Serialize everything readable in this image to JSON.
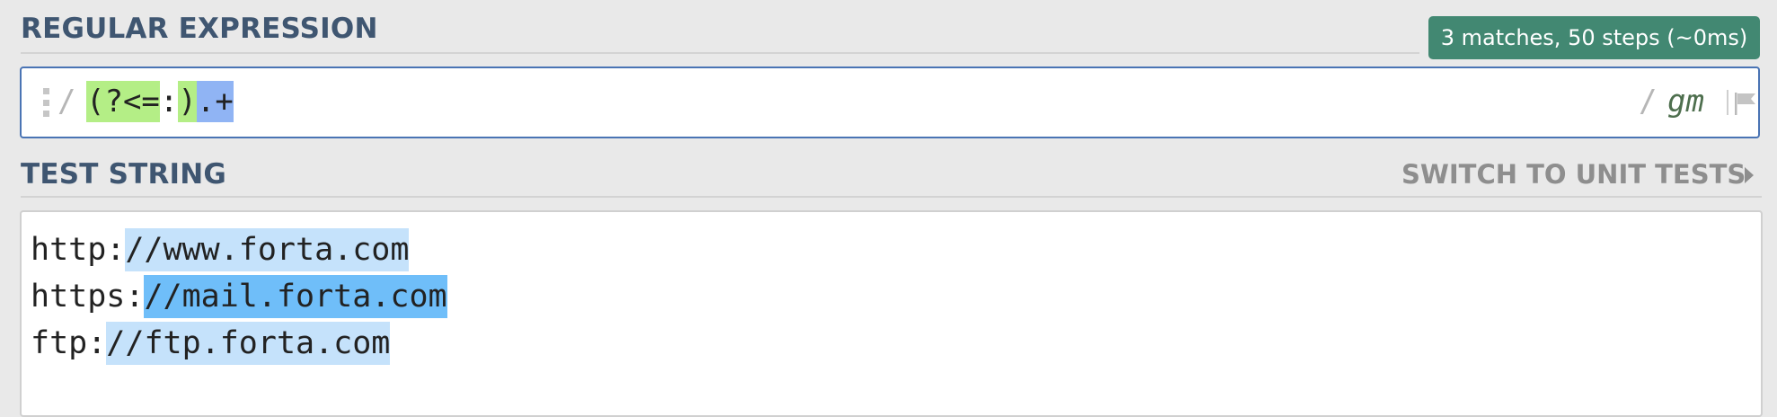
{
  "regex_section": {
    "label": "REGULAR EXPRESSION",
    "match_info": "3 matches, 50 steps (~0ms)",
    "delimiter_open": "/",
    "delimiter_close": "/",
    "pattern_tokens": [
      {
        "text": "(?<=",
        "kind": "group"
      },
      {
        "text": ":",
        "kind": "plain"
      },
      {
        "text": ")",
        "kind": "group"
      },
      {
        "text": ".+",
        "kind": "selected"
      }
    ],
    "flags": "gm",
    "flag_icon": "flag-icon"
  },
  "test_section": {
    "label": "TEST STRING",
    "switch_link": "SWITCH TO UNIT TESTS",
    "lines": [
      {
        "prefix": "http:",
        "match": "//www.forta.com",
        "active": false
      },
      {
        "prefix": "https:",
        "match": "//mail.forta.com",
        "active": true
      },
      {
        "prefix": "ftp:",
        "match": "//ftp.forta.com",
        "active": false
      }
    ]
  },
  "colors": {
    "label": "#3f5671",
    "badge": "#428872",
    "group_highlight": "#b4ee86",
    "selection_highlight": "#90b4f4",
    "match_light": "#c5e2fb",
    "match_active": "#6fbef9"
  }
}
